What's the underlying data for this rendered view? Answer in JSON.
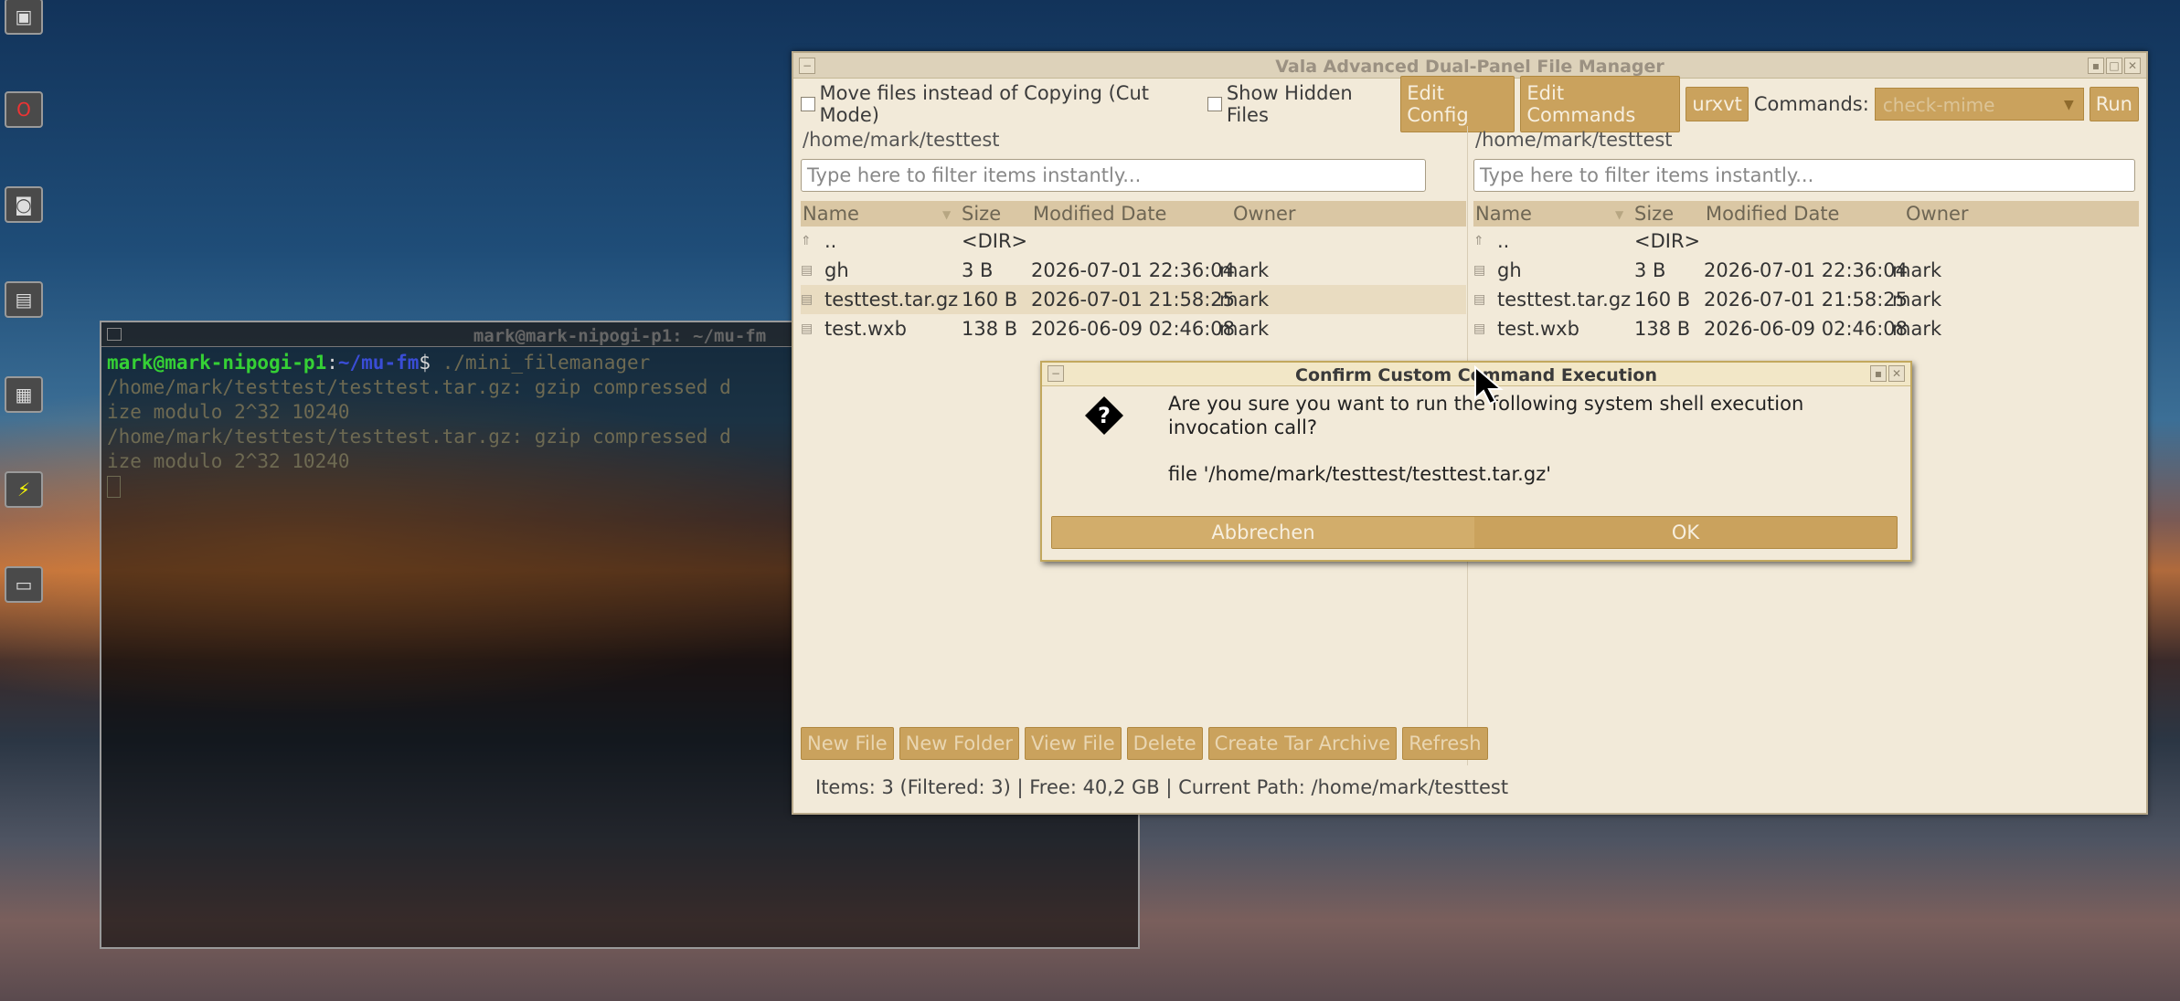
{
  "desktop": {
    "icons": [
      "terminal-icon",
      "opera-icon",
      "camera-icon",
      "drive-icon",
      "calculator-icon",
      "power-icon",
      "display-icon"
    ]
  },
  "terminal": {
    "title": "mark@mark-nipogi-p1: ~/mu-fm",
    "prompt_user": "mark@mark-nipogi-p1",
    "prompt_sep": ":",
    "prompt_path": "~/mu-fm",
    "prompt_end": "$",
    "command": " ./mini_filemanager",
    "lines": [
      "/home/mark/testtest/testtest.tar.gz: gzip compressed d",
      "ize modulo 2^32 10240",
      "/home/mark/testtest/testtest.tar.gz: gzip compressed d",
      "ize modulo 2^32 10240"
    ]
  },
  "filemanager": {
    "title": "Vala Advanced Dual-Panel File Manager",
    "toolbar": {
      "move_files_label": "Move files instead of Copying (Cut Mode)",
      "show_hidden_label": "Show Hidden Files",
      "edit_config": "Edit Config",
      "edit_commands": "Edit Commands",
      "urxvt": "urxvt",
      "commands_label": "Commands:",
      "commands_selected": "check-mime",
      "run": "Run"
    },
    "columns": [
      "Name",
      "Size",
      "Modified Date",
      "Owner"
    ],
    "left_panel": {
      "path": "/home/mark/testtest",
      "filter_placeholder": "Type here to filter items instantly...",
      "rows": [
        {
          "name": "..",
          "size": "<DIR>",
          "date": "",
          "owner": ""
        },
        {
          "name": "gh",
          "size": "3 B",
          "date": "2026-07-01 22:36:04",
          "owner": "mark"
        },
        {
          "name": "testtest.tar.gz",
          "size": "160 B",
          "date": "2026-07-01 21:58:25",
          "owner": "mark"
        },
        {
          "name": "test.wxb",
          "size": "138 B",
          "date": "2026-06-09 02:46:08",
          "owner": "mark"
        }
      ]
    },
    "right_panel": {
      "path": "/home/mark/testtest",
      "filter_placeholder": "Type here to filter items instantly...",
      "rows": [
        {
          "name": "..",
          "size": "<DIR>",
          "date": "",
          "owner": ""
        },
        {
          "name": "gh",
          "size": "3 B",
          "date": "2026-07-01 22:36:04",
          "owner": "mark"
        },
        {
          "name": "testtest.tar.gz",
          "size": "160 B",
          "date": "2026-07-01 21:58:25",
          "owner": "mark"
        },
        {
          "name": "test.wxb",
          "size": "138 B",
          "date": "2026-06-09 02:46:08",
          "owner": "mark"
        }
      ]
    },
    "bottom_buttons": {
      "new_file": "New File",
      "new_folder": "New Folder",
      "view_file": "View File",
      "delete": "Delete",
      "create_tar": "Create Tar Archive",
      "refresh": "Refresh"
    },
    "status": "Items: 3 (Filtered: 3) | Free: 40,2 GB | Current Path: /home/mark/testtest"
  },
  "dialog": {
    "title": "Confirm Custom Command Execution",
    "message": "Are you sure you want to run the following system shell execution invocation call?",
    "command": "file '/home/mark/testtest/testtest.tar.gz'",
    "cancel": "Abbrechen",
    "ok": "OK"
  },
  "colors": {
    "accent": "#caa25d",
    "window_bg": "#f2ead9",
    "header_bg": "#dac7a4",
    "terminal_green": "#35d035",
    "terminal_blue": "#3a4dd6"
  }
}
